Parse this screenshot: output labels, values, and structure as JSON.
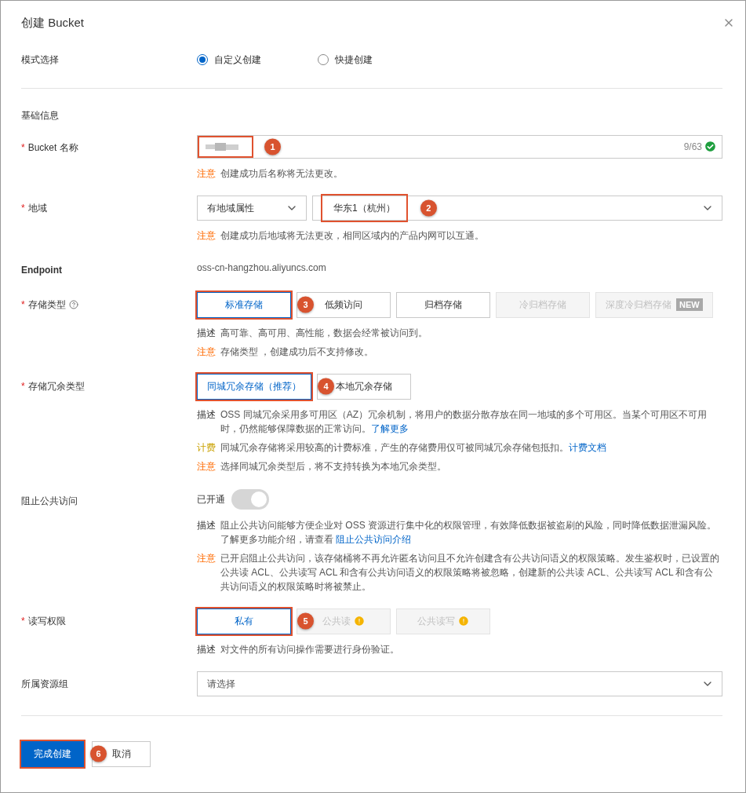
{
  "dialog": {
    "title": "创建 Bucket"
  },
  "mode": {
    "label": "模式选择",
    "options": [
      {
        "label": "自定义创建",
        "selected": true
      },
      {
        "label": "快捷创建",
        "selected": false
      }
    ]
  },
  "section_title": "基础信息",
  "fields": [
    {
      "kind": "name_input",
      "label": "Bucket 名称",
      "required_mark": "*",
      "help": false,
      "counter": "9/63",
      "valid": true,
      "annotation": "1",
      "notes": [
        {
          "kind": "warn",
          "tag": "注意",
          "text": "创建成功后名称将无法更改。"
        }
      ]
    },
    {
      "kind": "region",
      "label": "地域",
      "required_mark": "*",
      "help": false,
      "selects": [
        {
          "value": "有地域属性"
        },
        {
          "value": "华东1（杭州）",
          "annotation": "2"
        }
      ],
      "notes": [
        {
          "kind": "warn",
          "tag": "注意",
          "text": "创建成功后地域将无法更改，相同区域内的产品内网可以互通。"
        }
      ]
    },
    {
      "kind": "static",
      "label": "Endpoint",
      "help": false,
      "value": "oss-cn-hangzhou.aliyuncs.com"
    },
    {
      "kind": "options",
      "label": "存储类型",
      "required_mark": "*",
      "help": true,
      "annotation": "3",
      "options": [
        {
          "label": "标准存储",
          "selected": true,
          "disabled": false,
          "warning": false
        },
        {
          "label": "低频访问",
          "selected": false,
          "disabled": false,
          "warning": false
        },
        {
          "label": "归档存储",
          "selected": false,
          "disabled": false,
          "warning": false
        },
        {
          "label": "冷归档存储",
          "selected": false,
          "disabled": true,
          "warning": false
        },
        {
          "label": "深度冷归档存储",
          "selected": false,
          "disabled": true,
          "warning": false,
          "tag": "NEW"
        }
      ],
      "notes": [
        {
          "kind": "desc",
          "tag": "描述",
          "text": "高可靠、高可用、高性能，数据会经常被访问到。"
        },
        {
          "kind": "warn",
          "tag": "注意",
          "text": "存储类型 ，创建成功后不支持修改。"
        }
      ]
    },
    {
      "kind": "options",
      "label": "存储冗余类型",
      "required_mark": "*",
      "help": false,
      "annotation": "4",
      "options": [
        {
          "label": "同城冗余存储（推荐）",
          "selected": true,
          "disabled": false,
          "warning": false
        },
        {
          "label": "本地冗余存储",
          "selected": false,
          "disabled": false,
          "warning": false
        }
      ],
      "notes": [
        {
          "kind": "desc",
          "tag": "描述",
          "text": "OSS 同城冗余采用多可用区（AZ）冗余机制，将用户的数据分散存放在同一地域的多个可用区。当某个可用区不可用时，仍然能够保障数据的正常访问。",
          "link": "了解更多"
        },
        {
          "kind": "billing",
          "tag": "计费",
          "text": "同城冗余存储将采用较高的计费标准，产生的存储费用仅可被同城冗余存储包抵扣。",
          "link": "计费文档"
        },
        {
          "kind": "warn",
          "tag": "注意",
          "text": "选择同城冗余类型后，将不支持转换为本地冗余类型。"
        }
      ]
    },
    {
      "kind": "toggle",
      "label": "阻止公共访问",
      "help": false,
      "status": "已开通",
      "on": true,
      "disabled": true,
      "notes": [
        {
          "kind": "desc",
          "tag": "描述",
          "text": "阻止公共访问能够方便企业对 OSS 资源进行集中化的权限管理，有效降低数据被盗刷的风险，同时降低数据泄漏风险。了解更多功能介绍，请查看 ",
          "link": "阻止公共访问介绍"
        },
        {
          "kind": "warn",
          "tag": "注意",
          "text": "已开启阻止公共访问，该存储桶将不再允许匿名访问且不允许创建含有公共访问语义的权限策略。发生鉴权时，已设置的公共读 ACL、公共读写 ACL 和含有公共访问语义的权限策略将被忽略，创建新的公共读 ACL、公共读写 ACL 和含有公共访问语义的权限策略时将被禁止。"
        }
      ]
    },
    {
      "kind": "options",
      "label": "读写权限",
      "required_mark": "*",
      "help": false,
      "annotation": "5",
      "options": [
        {
          "label": "私有",
          "selected": true,
          "disabled": false,
          "warning": false
        },
        {
          "label": "公共读",
          "selected": false,
          "disabled": true,
          "warning": true
        },
        {
          "label": "公共读写",
          "selected": false,
          "disabled": true,
          "warning": true
        }
      ],
      "notes": [
        {
          "kind": "desc",
          "tag": "描述",
          "text": "对文件的所有访问操作需要进行身份验证。"
        }
      ]
    },
    {
      "kind": "select",
      "label": "所属资源组",
      "help": false,
      "placeholder": "请选择"
    }
  ],
  "footer": {
    "buttons": [
      {
        "label": "完成创建",
        "kind": "primary",
        "annotation": "6"
      },
      {
        "label": "取消",
        "kind": "default"
      }
    ]
  }
}
